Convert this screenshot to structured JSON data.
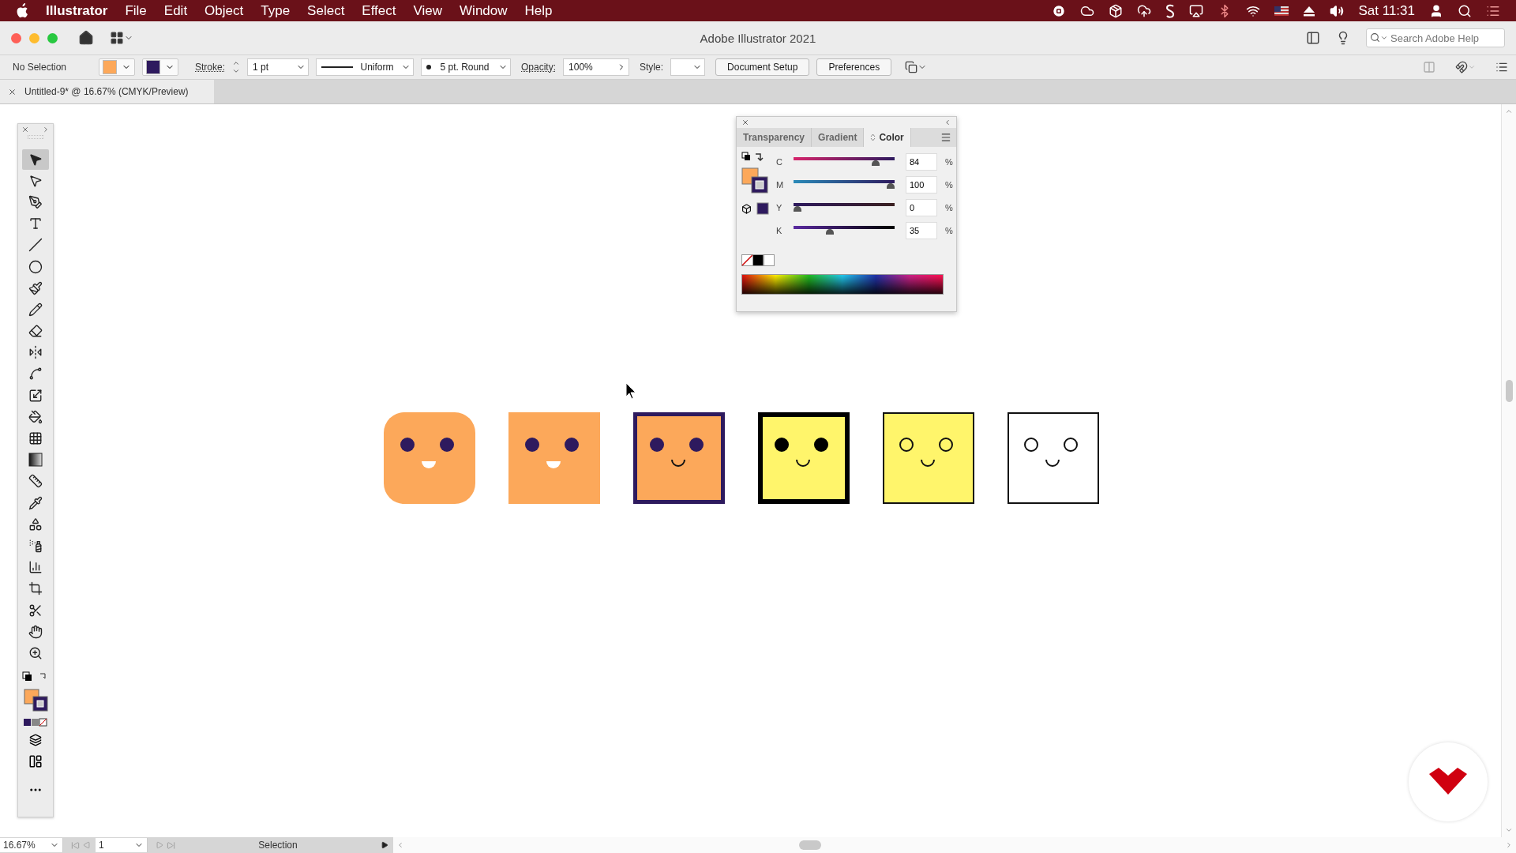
{
  "menu_bar": {
    "app": "Illustrator",
    "items": [
      "File",
      "Edit",
      "Object",
      "Type",
      "Select",
      "Effect",
      "View",
      "Window",
      "Help"
    ],
    "clock": "Sat 11:31"
  },
  "window": {
    "title": "Adobe Illustrator 2021",
    "search": {
      "placeholder": "Search Adobe Help"
    }
  },
  "control_bar": {
    "selection": "No Selection",
    "stroke_label": "Stroke:",
    "stroke_weight": "1 pt",
    "profile": "Uniform",
    "brush": "5 pt. Round",
    "opacity_label": "Opacity:",
    "opacity": "100%",
    "style_label": "Style:",
    "buttons": [
      "Document Setup",
      "Preferences"
    ]
  },
  "document_tab": {
    "title": "Untitled-9* @ 16.67% (CMYK/Preview)"
  },
  "tools": [
    {
      "kind": "selection",
      "selected": true
    },
    {
      "kind": "direct",
      "selected": false
    },
    {
      "kind": "pen",
      "selected": false
    },
    {
      "kind": "type",
      "selected": false
    },
    {
      "kind": "line",
      "selected": false
    },
    {
      "kind": "ellipse",
      "selected": false
    },
    {
      "kind": "brush",
      "selected": false
    },
    {
      "kind": "pencil",
      "selected": false
    },
    {
      "kind": "eraser",
      "selected": false
    },
    {
      "kind": "reflect",
      "selected": false
    },
    {
      "kind": "warp",
      "selected": false
    },
    {
      "kind": "scale",
      "selected": false
    },
    {
      "kind": "bucket",
      "selected": false
    },
    {
      "kind": "mesh",
      "selected": false
    },
    {
      "kind": "gradient",
      "selected": false
    },
    {
      "kind": "ruler",
      "selected": false
    },
    {
      "kind": "eyedropper",
      "selected": false
    },
    {
      "kind": "blend",
      "selected": false
    },
    {
      "kind": "spray",
      "selected": false
    },
    {
      "kind": "graph",
      "selected": false
    },
    {
      "kind": "artboard",
      "selected": false
    },
    {
      "kind": "knife",
      "selected": false
    },
    {
      "kind": "hand",
      "selected": false
    },
    {
      "kind": "zoom",
      "selected": false
    }
  ],
  "color_panel": {
    "tabs": [
      {
        "label": "Transparency",
        "selected": false
      },
      {
        "label": "Gradient",
        "selected": false
      },
      {
        "label": "Color",
        "selected": true
      }
    ],
    "channels": [
      {
        "name": "C",
        "value": "84",
        "unit": "%",
        "level": 0.84
      },
      {
        "name": "M",
        "value": "100",
        "unit": "%",
        "level": 1
      },
      {
        "name": "Y",
        "value": "0",
        "unit": "%",
        "level": 0
      },
      {
        "name": "K",
        "value": "35",
        "unit": "%",
        "level": 0.35
      }
    ]
  },
  "faces": [
    {
      "kind": "rounded",
      "color": "#fca85a"
    },
    {
      "kind": "plain",
      "color": "#fca85a"
    },
    {
      "kind": "framed",
      "color": "#fca85a"
    },
    {
      "kind": "bold",
      "color": "#fff56b"
    },
    {
      "kind": "outlined",
      "color": "#fff56b"
    },
    {
      "kind": "blank"
    }
  ],
  "status_bar": {
    "zoom": "16.67%",
    "artboard": "1",
    "tool": "Selection"
  }
}
